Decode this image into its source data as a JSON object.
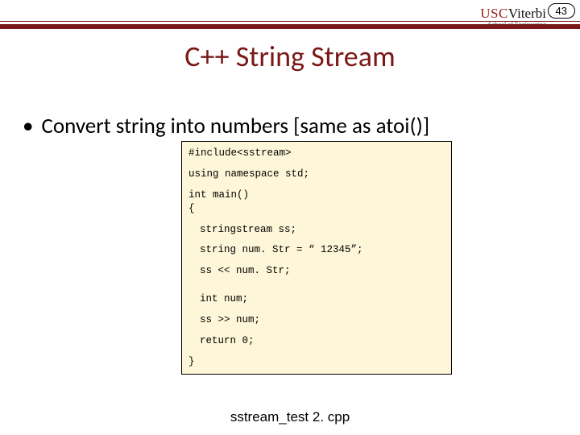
{
  "page_number": "43",
  "logo": {
    "usc": "USC",
    "viterbi": "Viterbi",
    "sub": "School of Engineering"
  },
  "title": "C++ String Stream",
  "bullet": "Convert string into numbers [same as atoi()]",
  "code": {
    "l1": "#include<sstream>",
    "l2": "using namespace std;",
    "l3": "int main()",
    "l4": "{",
    "l5": "stringstream ss;",
    "l6": "string num. Str = “ 12345”;",
    "l7": "ss << num. Str;",
    "l8": "int num;",
    "l9": "ss >> num;",
    "l10": "return 0;",
    "l11": "}"
  },
  "caption": "sstream_test 2. cpp"
}
